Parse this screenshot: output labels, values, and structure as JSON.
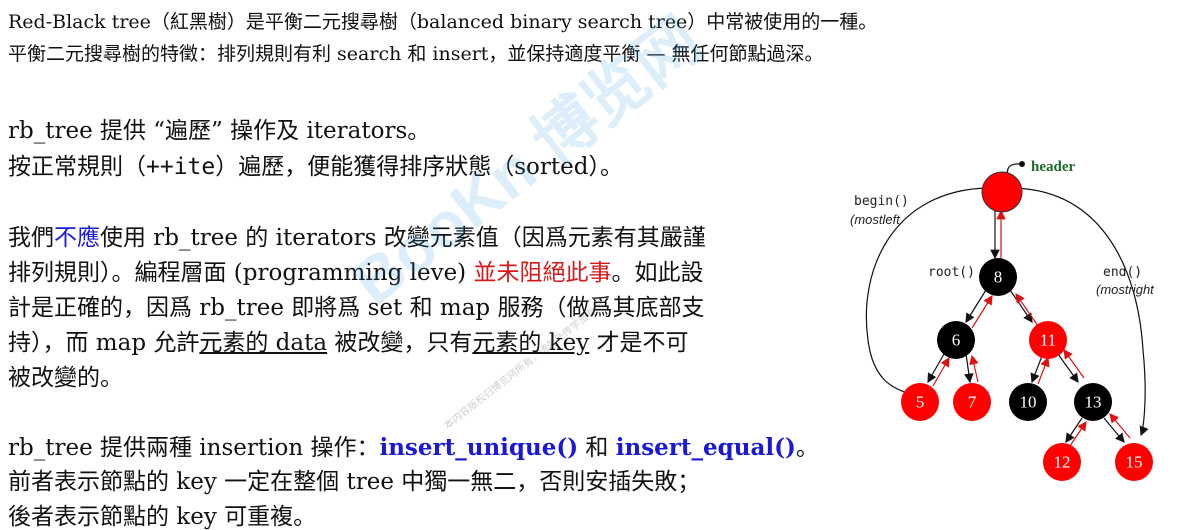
{
  "intro": {
    "line1": "Red-Black tree（紅黑樹）是平衡二元搜尋樹（balanced binary search tree）中常被使用的一種。",
    "line2": "平衡二元搜尋樹的特徵：排列規則有利 search 和 insert，並保持適度平衡 — 無任何節點過深。"
  },
  "para1": {
    "line1": "rb_tree 提供 “遍歷” 操作及 iterators。",
    "line2_a": "按正常規則（",
    "line2_code": "++ite",
    "line2_b": "）遍歷，便能獲得排序狀態（sorted）。"
  },
  "para2": {
    "l1_a": "我們",
    "l1_blue": "不應",
    "l1_b": "使用 rb_tree 的 iterators 改變元素值（因爲元素有其嚴謹",
    "l2_a": "排列規則）。編程層面 (programming leve) ",
    "l2_red": "並未阻絕此事",
    "l2_b": "。如此設",
    "l3": "計是正確的，因爲 rb_tree 即將爲 set 和 map 服務（做爲其底部支",
    "l4_a": "持），而 map 允許",
    "l4_u1": "元素的 data",
    "l4_b": " 被改變，只有",
    "l4_u2": "元素的 key",
    "l4_c": " 才是不可",
    "l5": "被改變的。"
  },
  "para3": {
    "l1_a": "rb_tree 提供兩種 insertion 操作：",
    "l1_f1": "insert_unique()",
    "l1_mid": " 和 ",
    "l1_f2": "insert_equal()",
    "l1_end": "。",
    "l2": "前者表示節點的 key 一定在整個 tree 中獨一無二，否則安插失敗；",
    "l3": "後者表示節點的 key 可重複。"
  },
  "diagram": {
    "header_label": "header",
    "begin_label": "begin()",
    "begin_sub": "(mostleft",
    "root_label": "root()",
    "end_label": "end()",
    "end_sub": "(mostright",
    "nodes": [
      "8",
      "6",
      "11",
      "5",
      "7",
      "10",
      "13",
      "12",
      "15"
    ],
    "colors": {
      "red": "#ff0000",
      "black": "#000000",
      "header": "#1b6b2b"
    }
  },
  "watermark": {
    "main": "BooKn 博览网",
    "sub": "本内容版权归博览网所有，请勿外传学员专用"
  }
}
